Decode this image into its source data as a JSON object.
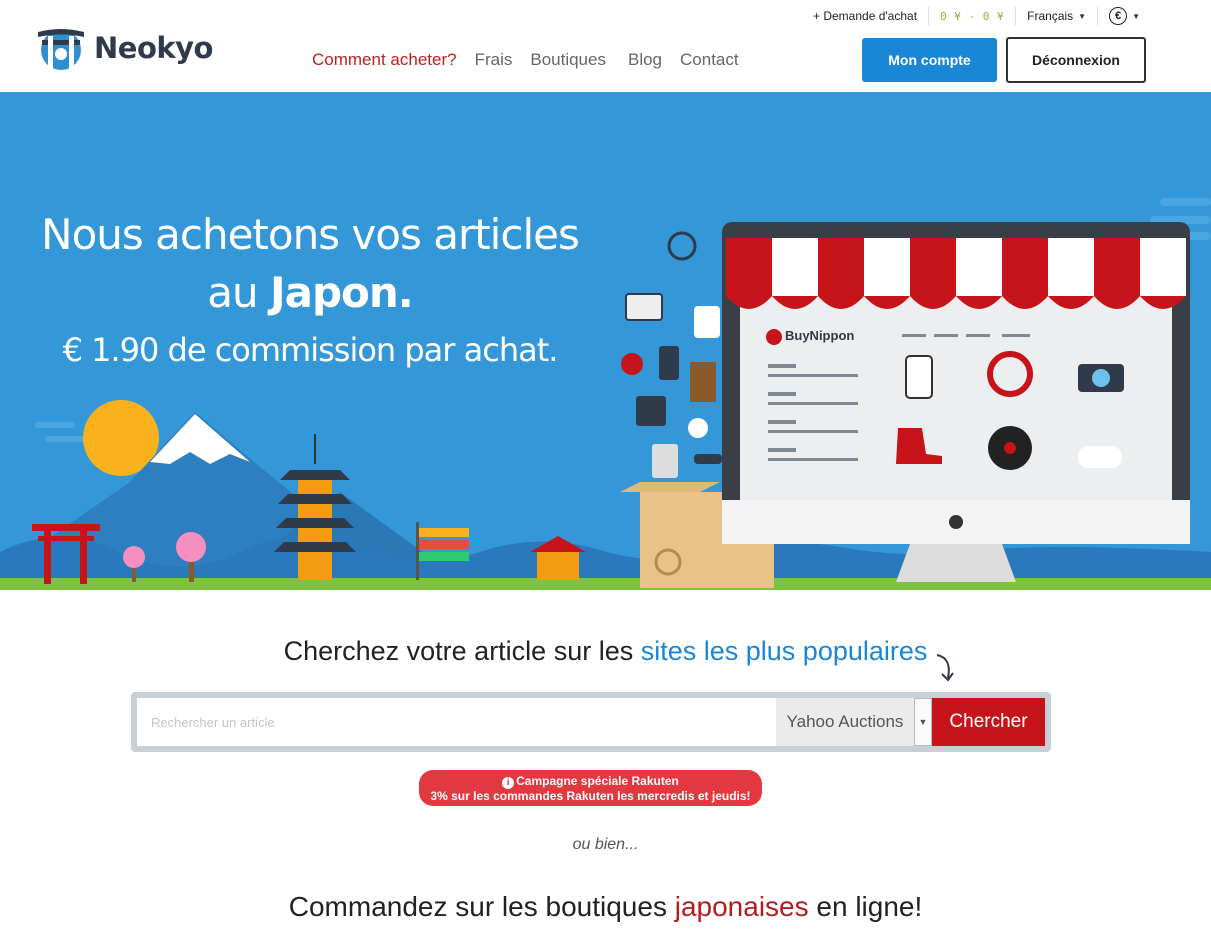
{
  "brand": {
    "name": "Neokyo"
  },
  "topbar": {
    "purchase_request": "+ Demande d'achat",
    "balance": "0 ¥ - 0 ¥",
    "language": "Français",
    "currency_symbol": "€"
  },
  "nav": {
    "items": [
      "Comment acheter?",
      "Frais",
      "Boutiques",
      "Blog",
      "Contact"
    ]
  },
  "account": {
    "my_account": "Mon compte",
    "logout": "Déconnexion"
  },
  "hero": {
    "line1": "Nous achetons vos articles",
    "line2_prefix": "au ",
    "line2_bold": "Japon.",
    "line3": "€ 1.90 de commission par achat.",
    "shop_brand": "BuyNippon"
  },
  "search": {
    "title_prefix": "Cherchez votre article sur les ",
    "title_highlight": "sites les plus populaires",
    "placeholder": "Rechercher un article",
    "selected_site": "Yahoo Auctions",
    "button": "Chercher"
  },
  "promo": {
    "title": "Campagne spéciale Rakuten",
    "detail": "3% sur les commandes Rakuten les mercredis et jeudis!"
  },
  "or_text": "ou bien...",
  "order": {
    "prefix": "Commandez sur les boutiques ",
    "highlight": "japonaises",
    "suffix": " en ligne!"
  },
  "colors": {
    "primary_blue": "#1a87d6",
    "hero_blue": "#3498d8",
    "brand_red": "#c7141a",
    "nav_active": "#c21d1d",
    "promo_red": "#e23840"
  }
}
